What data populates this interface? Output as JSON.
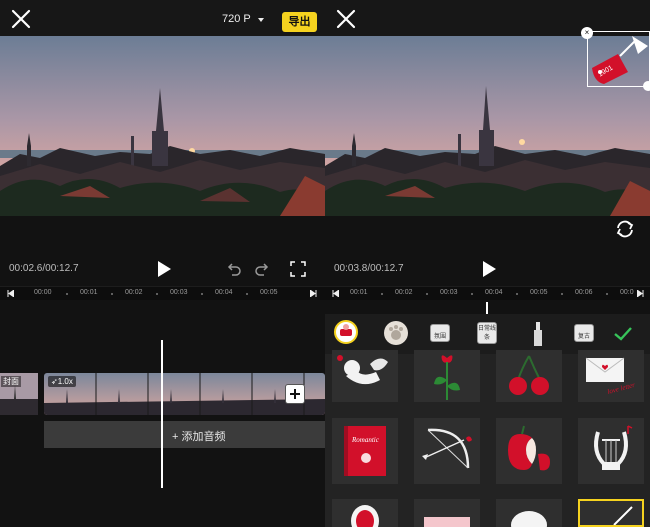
{
  "left": {
    "resolution": "720 P",
    "export_label": "导出",
    "time_readout": "00:02.6/00:12.7",
    "ruler_labels": [
      "00:00",
      "00:01",
      "00:02",
      "00:03",
      "00:04",
      "00:05"
    ],
    "cover_label": "封面",
    "speed_label": "1.0x",
    "add_audio_label": "+ 添加音频",
    "icons": {
      "close": "close-icon",
      "dropdown": "caret-down-icon",
      "play": "play-icon",
      "undo": "undo-icon",
      "redo": "redo-icon",
      "fullscreen": "fullscreen-icon",
      "add_clip": "plus-icon"
    }
  },
  "right": {
    "time_readout": "00:03.8/00:12.7",
    "ruler_labels": [
      "00:01",
      "00:02",
      "00:03",
      "00:04",
      "00:05",
      "00:06",
      "00:0"
    ],
    "sticker_label": "1901",
    "category_tabs": [
      {
        "label": "",
        "icon": "sticker-category-icon"
      },
      {
        "label": "",
        "icon": "pet-paw-icon"
      },
      {
        "label": "氛围",
        "icon": "tag-icon"
      },
      {
        "label": "日常线条",
        "icon": "tag-icon"
      },
      {
        "label": "",
        "icon": "lipstick-icon"
      },
      {
        "label": "复古",
        "icon": "tag-icon"
      }
    ],
    "confirm_icon": "check-icon",
    "rotate_icon": "rotate-icon",
    "stickers": [
      {
        "name": "cupid",
        "icon": "cupid-sticker-icon"
      },
      {
        "name": "rose",
        "icon": "rose-sticker-icon"
      },
      {
        "name": "cherries",
        "icon": "cherries-sticker-icon"
      },
      {
        "name": "love-letter",
        "icon": "letter-sticker-icon",
        "text": "love letter"
      },
      {
        "name": "romantic-book",
        "icon": "book-sticker-icon",
        "text": "Romantic"
      },
      {
        "name": "bow-arrow",
        "icon": "bow-arrow-sticker-icon"
      },
      {
        "name": "apple",
        "icon": "apple-sticker-icon"
      },
      {
        "name": "lyre",
        "icon": "lyre-sticker-icon"
      }
    ]
  },
  "colors": {
    "accent_yellow": "#f5d21f",
    "confirm_green": "#37c45a",
    "sticker_red": "#d2102a"
  }
}
